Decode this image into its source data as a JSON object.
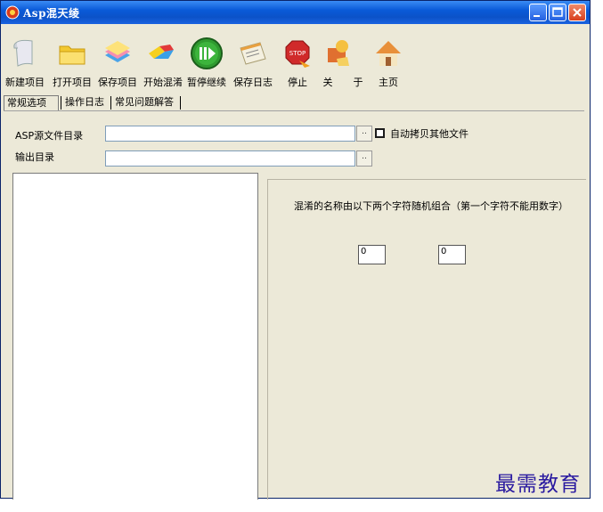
{
  "window": {
    "title": "Asp混天绫",
    "controls": [
      "minimize",
      "maximize",
      "close"
    ]
  },
  "toolbar": {
    "items": [
      {
        "label": "新建项目",
        "icon": "new-project-icon"
      },
      {
        "label": "打开项目",
        "icon": "open-project-icon"
      },
      {
        "label": "保存项目",
        "icon": "save-project-icon"
      },
      {
        "label": "开始混淆",
        "icon": "start-obfuscate-icon"
      },
      {
        "label": "暂停继续",
        "icon": "pause-resume-icon"
      },
      {
        "label": "保存日志",
        "icon": "save-log-icon"
      },
      {
        "label": "停止",
        "icon": "stop-icon"
      },
      {
        "label": "关",
        "icon": "about-icon"
      },
      {
        "label": "于",
        "icon": ""
      },
      {
        "label": "主页",
        "icon": "home-icon"
      }
    ]
  },
  "tabs": [
    {
      "label": "常规选项",
      "active": true
    },
    {
      "label": "操作日志",
      "active": false
    },
    {
      "label": "常见问题解答",
      "active": false
    }
  ],
  "form": {
    "source_dir_label": "ASP源文件目录",
    "source_dir_value": "",
    "output_dir_label": "输出目录",
    "output_dir_value": "",
    "browse_label": "..",
    "copy_other_files_label": "自动拷贝其他文件",
    "copy_other_files_checked": false
  },
  "options": {
    "description": "混淆的名称由以下两个字符随机组合（第一个字符不能用数字）",
    "char1": "0",
    "char2": "0"
  },
  "watermark": "最需教育",
  "colors": {
    "titlebar": "#0b52c8",
    "window_bg": "#ece9d8",
    "close_button": "#d8401e",
    "watermark": "#2a1aa0"
  }
}
